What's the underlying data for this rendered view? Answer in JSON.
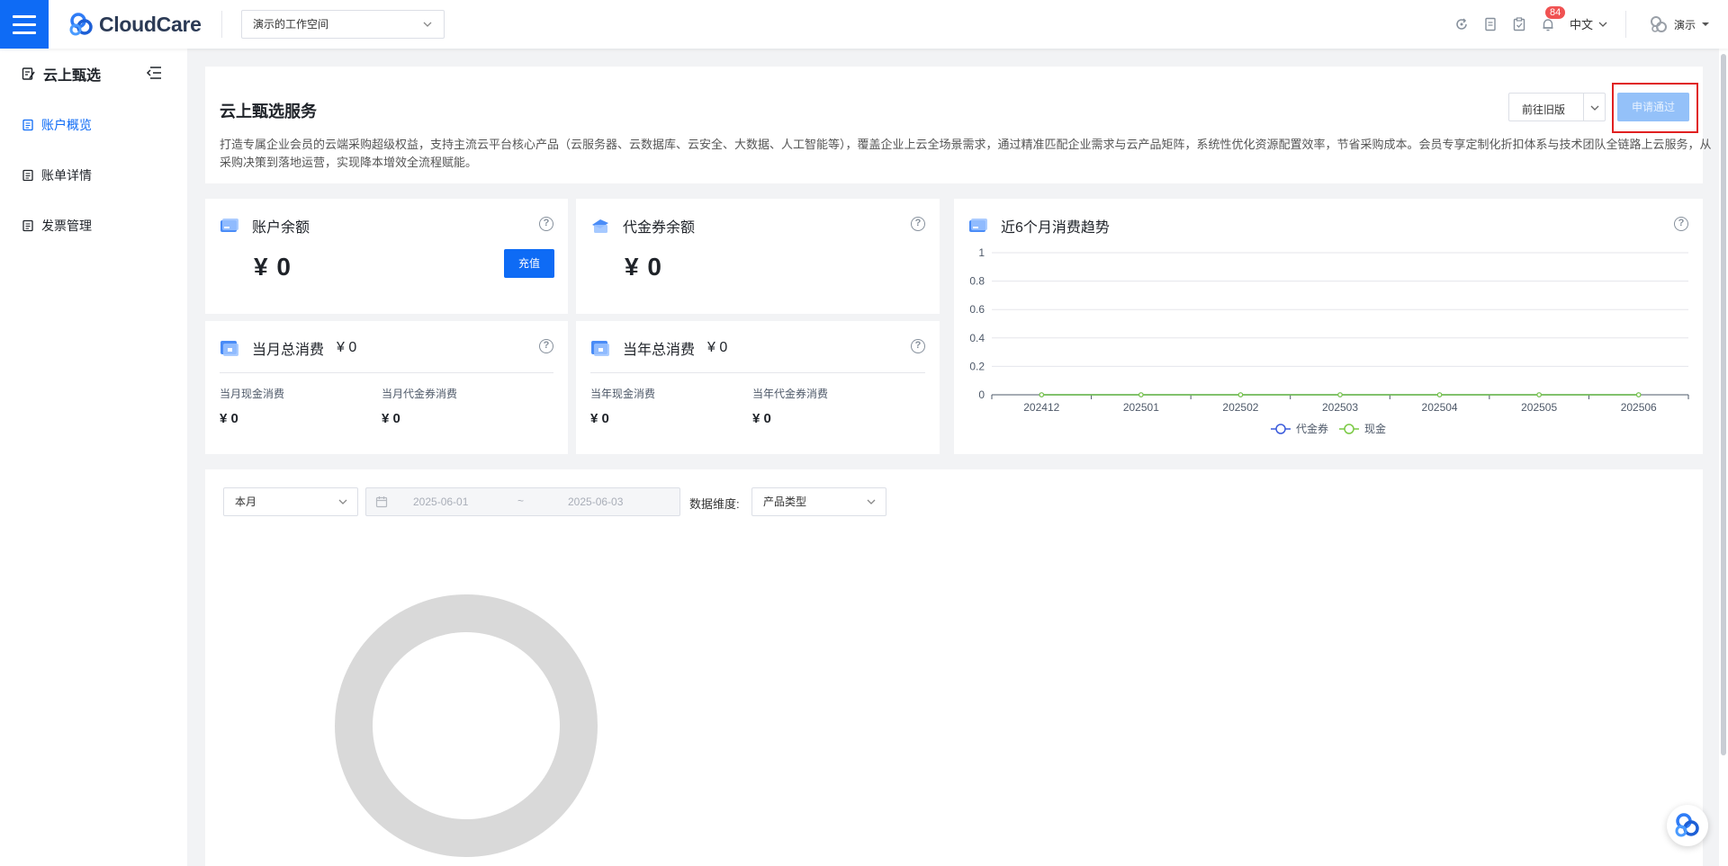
{
  "topbar": {
    "brand": "CloudCare",
    "workspace": "演示的工作空间",
    "notification_count": "84",
    "language": "中文",
    "user_name": "演示",
    "icons": [
      "refresh-icon",
      "document-icon",
      "clipboard-icon",
      "bell-icon"
    ]
  },
  "sidebar": {
    "title": "云上甄选",
    "items": [
      {
        "label": "账户概览",
        "active": true
      },
      {
        "label": "账单详情",
        "active": false
      },
      {
        "label": "发票管理",
        "active": false
      }
    ]
  },
  "intro": {
    "title": "云上甄选服务",
    "description": "打造专属企业会员的云端采购超级权益，支持主流云平台核心产品（云服务器、云数据库、云安全、大数据、人工智能等），覆盖企业上云全场景需求，通过精准匹配企业需求与云产品矩阵，系统性优化资源配置效率，节省采购成本。会员专享定制化折扣体系与技术团队全链路上云服务，从采购决策到落地运营，实现降本增效全流程赋能。",
    "old_version_label": "前往旧版",
    "apply_label": "申请通过"
  },
  "cards": {
    "balance": {
      "title": "账户余额",
      "amount": "¥ 0",
      "recharge_label": "充值"
    },
    "voucher": {
      "title": "代金券余额",
      "amount": "¥ 0"
    },
    "month": {
      "title": "当月总消费",
      "total": "¥ 0",
      "cash_label": "当月现金消费",
      "cash_value": "¥ 0",
      "voucher_label": "当月代金券消费",
      "voucher_value": "¥ 0"
    },
    "year": {
      "title": "当年总消费",
      "total": "¥ 0",
      "cash_label": "当年现金消费",
      "cash_value": "¥ 0",
      "voucher_label": "当年代金券消费",
      "voucher_value": "¥ 0"
    },
    "trend": {
      "title": "近6个月消费趋势"
    }
  },
  "chart_data": {
    "type": "line",
    "title": "近6个月消费趋势",
    "categories": [
      "202412",
      "202501",
      "202502",
      "202503",
      "202504",
      "202505",
      "202506"
    ],
    "series": [
      {
        "name": "代金券",
        "color": "#3b5bdb",
        "values": [
          0,
          0,
          0,
          0,
          0,
          0,
          0
        ]
      },
      {
        "name": "现金",
        "color": "#7ac943",
        "values": [
          0,
          0,
          0,
          0,
          0,
          0,
          0
        ]
      }
    ],
    "ylim": [
      0,
      1
    ],
    "yticks": [
      "1",
      "0.8",
      "0.6",
      "0.4",
      "0.2",
      "0"
    ],
    "legend": "bottom-center",
    "grid": true
  },
  "filters": {
    "period": "本月",
    "start_date": "2025-06-01",
    "range_sep": "~",
    "end_date": "2025-06-03",
    "dimension_label": "数据维度:",
    "dimension": "产品类型"
  },
  "colors": {
    "primary": "#0e6bf5",
    "highlight": "#e02020",
    "donut": "#d9d9d9"
  }
}
